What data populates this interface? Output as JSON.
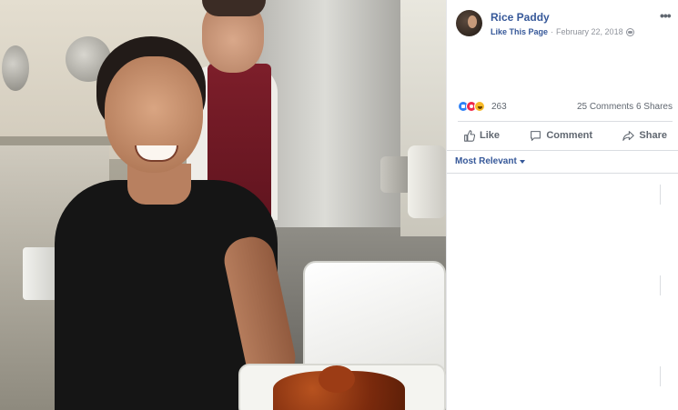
{
  "post": {
    "page_name": "Rice Paddy",
    "like_page": "Like This Page",
    "separator": "·",
    "date": "February 22, 2018"
  },
  "reactions": {
    "count": "263",
    "comments": "25 Comments",
    "shares": "6 Shares",
    "types": [
      "like-icon",
      "love-icon",
      "haha-icon"
    ]
  },
  "actions": {
    "like": "Like",
    "comment": "Comment",
    "share": "Share"
  },
  "comments": {
    "sort_label": "Most Relevant"
  },
  "colors": {
    "link_blue": "#365899",
    "muted_text": "#606770",
    "like_blue": "#2e81f6",
    "love_red": "#f0284a",
    "haha_yellow": "#f7b928"
  }
}
